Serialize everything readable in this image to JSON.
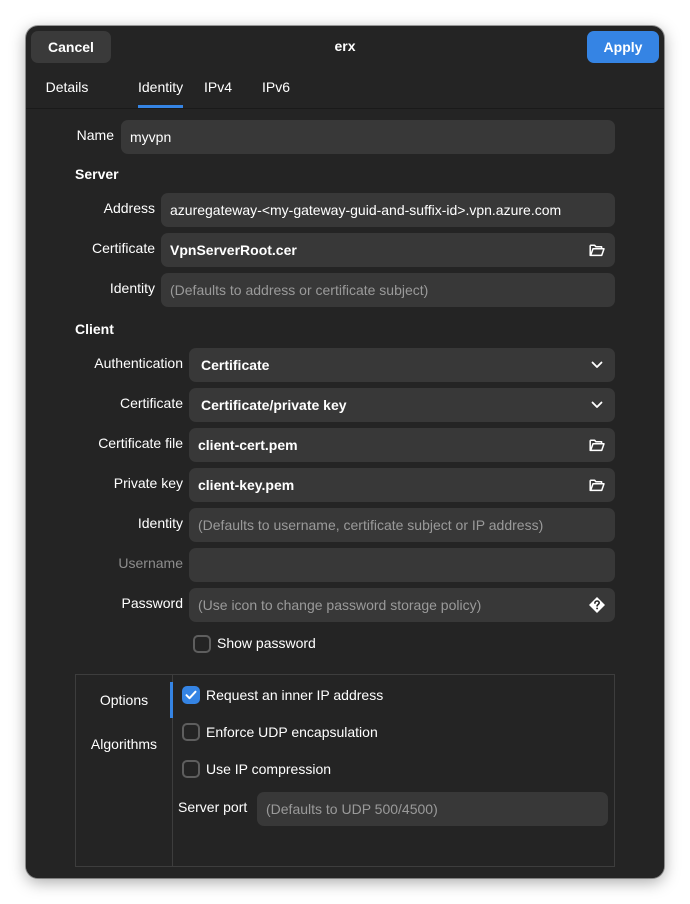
{
  "header": {
    "title": "erx",
    "cancel_label": "Cancel",
    "apply_label": "Apply"
  },
  "tabs": [
    {
      "label": "Details"
    },
    {
      "label": "Identity",
      "active": true
    },
    {
      "label": "IPv4"
    },
    {
      "label": "IPv6"
    }
  ],
  "name": {
    "label": "Name",
    "value": "myvpn"
  },
  "server": {
    "heading": "Server",
    "address_label": "Address",
    "address_value": "azuregateway-<my-gateway-guid-and-suffix-id>.vpn.azure.com",
    "certificate_label": "Certificate",
    "certificate_value": "VpnServerRoot.cer",
    "identity_label": "Identity",
    "identity_placeholder": "(Defaults to address or certificate subject)"
  },
  "client": {
    "heading": "Client",
    "authentication_label": "Authentication",
    "authentication_value": "Certificate",
    "certificate_label": "Certificate",
    "certificate_value": "Certificate/private key",
    "certificate_file_label": "Certificate file",
    "certificate_file_value": "client-cert.pem",
    "private_key_label": "Private key",
    "private_key_value": "client-key.pem",
    "identity_label": "Identity",
    "identity_placeholder": "(Defaults to username, certificate subject or IP address)",
    "username_label": "Username",
    "password_label": "Password",
    "password_placeholder": "(Use icon to change password storage policy)",
    "show_password_label": "Show password",
    "show_password_checked": false
  },
  "options": {
    "sidebar": [
      {
        "label": "Options",
        "active": true
      },
      {
        "label": "Algorithms"
      }
    ],
    "request_inner_ip_label": "Request an inner IP address",
    "request_inner_ip_checked": true,
    "enforce_udp_label": "Enforce UDP encapsulation",
    "enforce_udp_checked": false,
    "ip_compression_label": "Use IP compression",
    "ip_compression_checked": false,
    "server_port_label": "Server port",
    "server_port_placeholder": "(Defaults to UDP 500/4500)"
  },
  "colors": {
    "accent": "#3584e4",
    "window_bg": "#242424",
    "entry_bg": "#383838"
  },
  "icons": {
    "file_chooser": "folder-open-icon",
    "dropdown": "chevron-down-icon",
    "password_policy": "question-diamond-icon",
    "check": "checkmark-icon"
  }
}
